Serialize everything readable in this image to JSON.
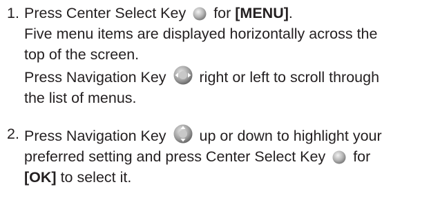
{
  "step1": {
    "number": "1.",
    "line1_pre": "Press Center Select Key",
    "line1_mid": "for",
    "line1_bold": "[MENU]",
    "line1_post": ".",
    "line2": "Five menu items are displayed horizontally across the",
    "line3": "top of the screen.",
    "line4_pre": "Press Navigation Key",
    "line4_post": "right or left to scroll through",
    "line5": "the list of menus.",
    "icons": [
      "center-select-key-icon",
      "navigation-key-left-right-icon"
    ]
  },
  "step2": {
    "number": "2.",
    "line1_pre": "Press Navigation Key",
    "line1_post": "up or down to highlight your",
    "line2_pre": "preferred setting and press Center Select Key",
    "line2_post": "for",
    "line3_bold": "[OK]",
    "line3_post": "to select it.",
    "icons": [
      "navigation-key-up-down-icon",
      "center-select-key-icon"
    ]
  }
}
